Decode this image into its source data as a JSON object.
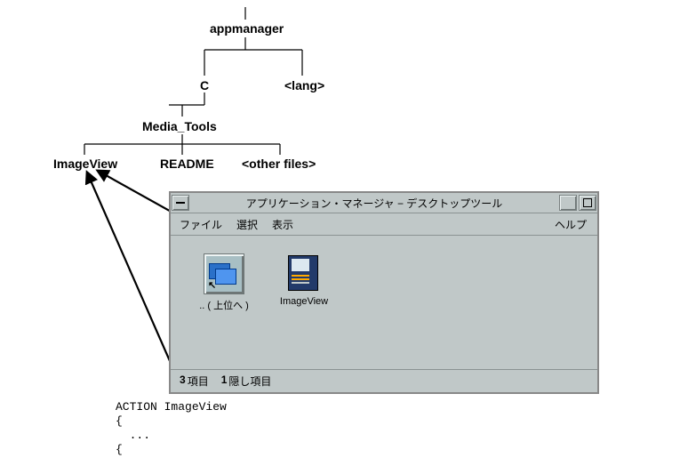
{
  "tree": {
    "root": "appmanager",
    "left1": "C",
    "right1": "<lang>",
    "left2": "Media_Tools",
    "c1": "ImageView",
    "c2": "README",
    "c3": "<other files>"
  },
  "window": {
    "title": "アプリケーション・マネージャ − デスクトップツール",
    "menu": {
      "file": "ファイル",
      "select": "選択",
      "view": "表示",
      "help": "ヘルプ"
    },
    "icons": {
      "up": ".. ( 上位へ )",
      "iv": "ImageView"
    },
    "status": {
      "n1": "3",
      "l1": "項目",
      "n2": "1",
      "l2": "隠し項目"
    }
  },
  "code": {
    "line1": "ACTION ImageView",
    "line2": "{",
    "line3": "  ...",
    "line4": "{"
  }
}
